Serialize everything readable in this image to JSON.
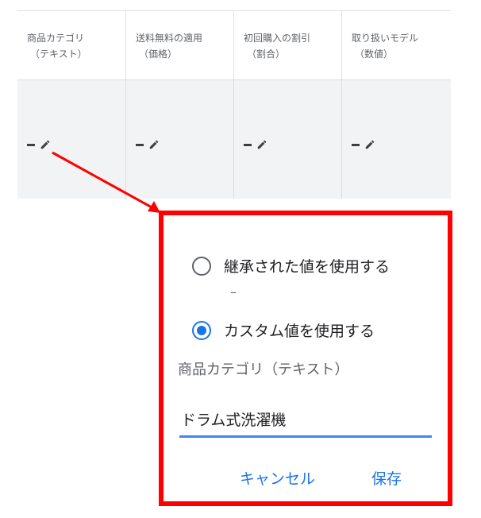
{
  "table": {
    "columns": [
      {
        "line1": "商品カテゴリ",
        "line2": "（テキスト）"
      },
      {
        "line1": "送料無料の適用",
        "line2": "（価格）"
      },
      {
        "line1": "初回購入の割引",
        "line2": "（割合）"
      },
      {
        "line1": "取り扱いモデル",
        "line2": "（数値）"
      }
    ],
    "cells": [
      "–",
      "–",
      "–",
      "–"
    ]
  },
  "popup": {
    "option_inherited_label": "継承された値を使用する",
    "inherited_value": "–",
    "option_custom_label": "カスタム値を使用する",
    "field_label": "商品カテゴリ（テキスト）",
    "field_value": "ドラム式洗濯機",
    "cancel_label": "キャンセル",
    "save_label": "保存"
  },
  "colors": {
    "highlight": "#ff0000",
    "accent": "#1a73e8",
    "table_body_bg": "#f1f3f4"
  },
  "icons": {
    "cell_edit": "pencil-icon"
  }
}
